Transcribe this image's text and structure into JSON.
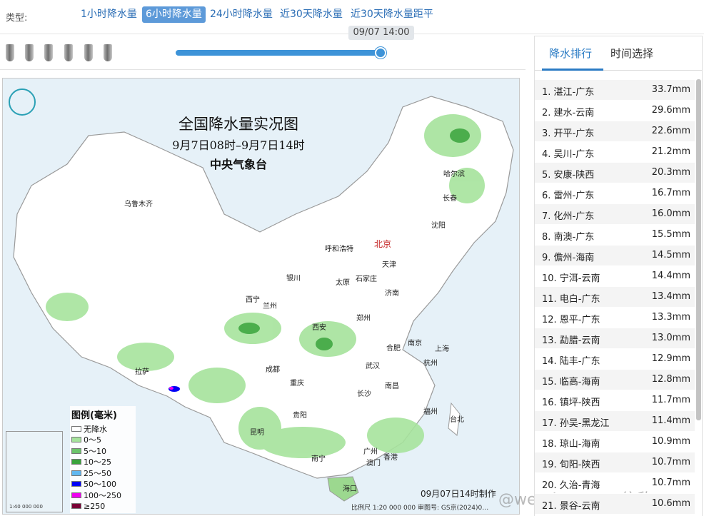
{
  "typebar": {
    "label": "类型:",
    "tabs": [
      {
        "label": "1小时降水量",
        "active": false
      },
      {
        "label": "6小时降水量",
        "active": true
      },
      {
        "label": "24小时降水量",
        "active": false
      },
      {
        "label": "近30天降水量",
        "active": false
      },
      {
        "label": "近30天降水量距平",
        "active": false
      }
    ]
  },
  "timeline": {
    "current_time": "09/07 14:00",
    "progress": 1.0
  },
  "map": {
    "title": "全国降水量实况图",
    "subtitle": "9月7日08时–9月7日14时",
    "agency": "中央气象台",
    "capital": "北京",
    "cities": [
      "乌鲁木齐",
      "哈尔滨",
      "长春",
      "沈阳",
      "呼和浩特",
      "天津",
      "银川",
      "太原",
      "石家庄",
      "济南",
      "西宁",
      "兰州",
      "西安",
      "郑州",
      "合肥",
      "南京",
      "上海",
      "拉萨",
      "成都",
      "武汉",
      "杭州",
      "重庆",
      "长沙",
      "南昌",
      "福州",
      "台北",
      "贵阳",
      "昆明",
      "南宁",
      "广州",
      "香港",
      "澳门",
      "海口"
    ],
    "legend": {
      "title": "图例(毫米)",
      "items": [
        {
          "label": "无降水",
          "color": "#ffffff"
        },
        {
          "label": "0～5",
          "color": "#a6e39c"
        },
        {
          "label": "5～10",
          "color": "#6cc46a"
        },
        {
          "label": "10～25",
          "color": "#3aa33c"
        },
        {
          "label": "25～50",
          "color": "#62b8f0"
        },
        {
          "label": "50～100",
          "color": "#0000f5"
        },
        {
          "label": "100～250",
          "color": "#f000f0"
        },
        {
          "label": "≥250",
          "color": "#7a0036"
        }
      ]
    },
    "made_text": "09月07日14时制作",
    "scale_text": "比例尺 1:20 000 000     审图号: GS京(2024)0…",
    "inset_scale": "1:40 000 000"
  },
  "watermark": "@weatherman_信欣",
  "panel": {
    "tabs": [
      {
        "label": "降水排行",
        "active": true
      },
      {
        "label": "时间选择",
        "active": false
      }
    ],
    "ranking": [
      {
        "name": "1. 湛江-广东",
        "value": "33.7mm"
      },
      {
        "name": "2. 建水-云南",
        "value": "29.6mm"
      },
      {
        "name": "3. 开平-广东",
        "value": "22.6mm"
      },
      {
        "name": "4. 吴川-广东",
        "value": "21.2mm"
      },
      {
        "name": "5. 安康-陕西",
        "value": "20.3mm"
      },
      {
        "name": "6. 雷州-广东",
        "value": "16.7mm"
      },
      {
        "name": "7. 化州-广东",
        "value": "16.0mm"
      },
      {
        "name": "8. 南澳-广东",
        "value": "15.5mm"
      },
      {
        "name": "9. 儋州-海南",
        "value": "14.5mm"
      },
      {
        "name": "10. 宁洱-云南",
        "value": "14.4mm"
      },
      {
        "name": "11. 电白-广东",
        "value": "13.4mm"
      },
      {
        "name": "12. 恩平-广东",
        "value": "13.3mm"
      },
      {
        "name": "13. 勐腊-云南",
        "value": "13.0mm"
      },
      {
        "name": "14. 陆丰-广东",
        "value": "12.9mm"
      },
      {
        "name": "15. 临高-海南",
        "value": "12.8mm"
      },
      {
        "name": "16. 镇坪-陕西",
        "value": "11.7mm"
      },
      {
        "name": "17. 孙吴-黑龙江",
        "value": "11.4mm"
      },
      {
        "name": "18. 琼山-海南",
        "value": "10.9mm"
      },
      {
        "name": "19. 旬阳-陕西",
        "value": "10.7mm"
      },
      {
        "name": "20. 久治-青海",
        "value": "10.7mm"
      },
      {
        "name": "21. 景谷-云南",
        "value": "10.6mm"
      }
    ]
  }
}
